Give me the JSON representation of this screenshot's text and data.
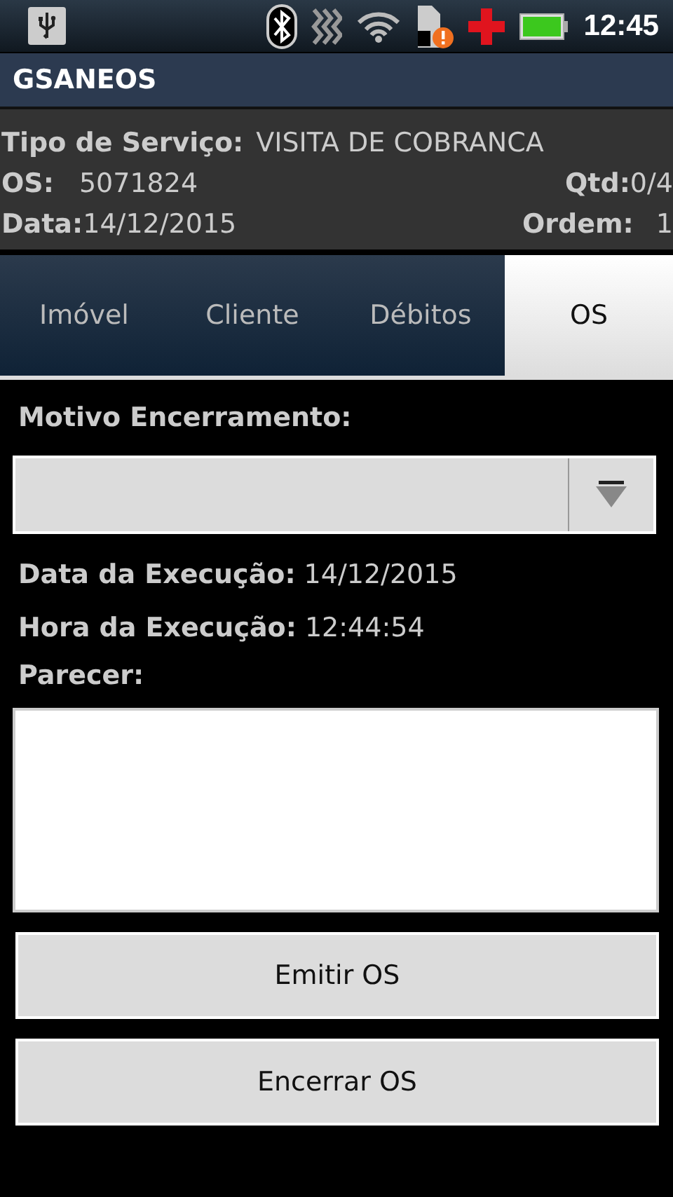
{
  "status_bar": {
    "time": "12:45"
  },
  "app_title": "GSANEOS",
  "info": {
    "service_type": {
      "label": "Tipo de Serviço:",
      "value": "VISITA DE COBRANCA"
    },
    "os": {
      "label": "OS:",
      "value": "5071824"
    },
    "qtd": {
      "label": "Qtd:",
      "value": "0/4"
    },
    "date": {
      "label": "Data:",
      "value": "14/12/2015"
    },
    "order": {
      "label": "Ordem:",
      "value": "1"
    }
  },
  "tabs": [
    {
      "label": "Imóvel",
      "selected": false
    },
    {
      "label": "Cliente",
      "selected": false
    },
    {
      "label": "Débitos",
      "selected": false
    },
    {
      "label": "OS",
      "selected": true
    }
  ],
  "form": {
    "reason_label": "Motivo Encerramento:",
    "details": [
      {
        "label": "Data da Execução:",
        "value": "14/12/2015"
      },
      {
        "label": "Hora da Execução:",
        "value": "12:44:54"
      }
    ],
    "opinion_label": "Parecer:",
    "buttons": [
      "Emitir OS",
      "Encerrar OS"
    ]
  }
}
